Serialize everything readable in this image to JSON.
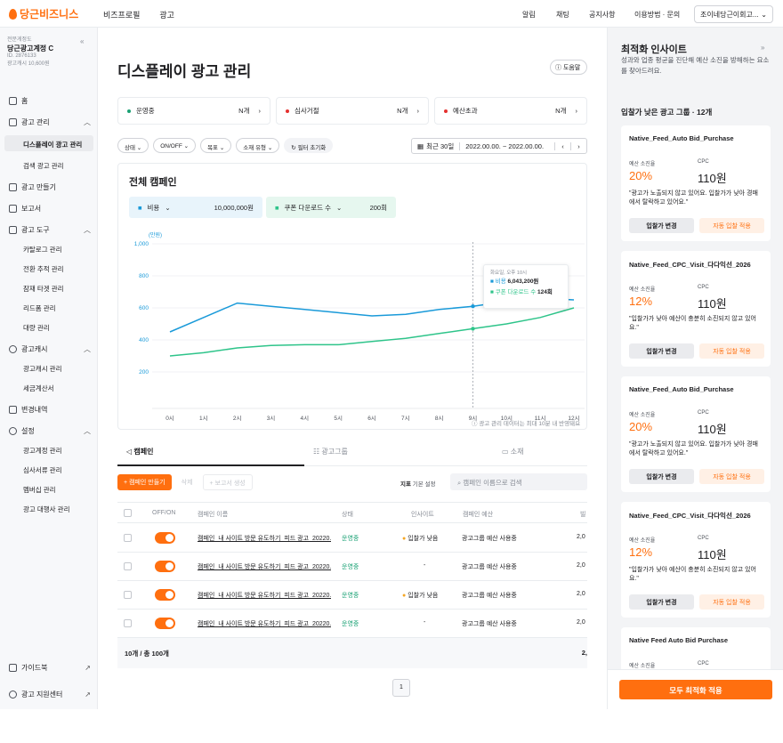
{
  "brand": {
    "logo": "당근비즈니스"
  },
  "topnav": [
    "비즈프로필",
    "광고"
  ],
  "topright": {
    "alarm": "알림",
    "chat": "채팅",
    "notice": "공지사항",
    "guide": "이용방법 · 문의",
    "account": "조이네당근이회고..."
  },
  "sidebar": {
    "acct_tag": "전문게정도",
    "acct_name": "당근광고계정 C",
    "acct_id": "ID. 2876133",
    "acct_money": "광고캐시 10,600원",
    "items": {
      "home": "홈",
      "ad_manage": "광고 관리",
      "display": "디스플레이 광고 관리",
      "search": "검색 광고 관리",
      "make": "광고 만들기",
      "report": "보고서",
      "tools": "광고 도구",
      "catalog": "카탈로그 관리",
      "conv": "전환 추적 관리",
      "audience": "잠재 타겟 관리",
      "retarget": "리드폼 관리",
      "etc": "대량 관리",
      "cash": "광고캐시",
      "cash_manage": "광고캐시 관리",
      "tax": "세금계산서",
      "history": "변경내역",
      "settings": "설정",
      "acct_manage": "광고계정 관리",
      "docs": "심사서류 관리",
      "members": "멤버십 관리",
      "agency": "광고 대행사 관리",
      "guidebook": "가이드북",
      "support": "광고 지원센터"
    }
  },
  "main": {
    "title": "디스플레이 광고 관리",
    "help": "도움말",
    "status": [
      {
        "label": "운영중",
        "count": "N개",
        "color": "#1aa174"
      },
      {
        "label": "심사거절",
        "count": "N개",
        "color": "#e5302e"
      },
      {
        "label": "예산초과",
        "count": "N개",
        "color": "#e5302e"
      }
    ],
    "filters": [
      "상태",
      "ON/OFF",
      "목표",
      "소재 유형",
      "필터 초기화"
    ],
    "date_label": "최근 30일",
    "date_range": "2022.00.00. ~ 2022.00.00.",
    "chart_title": "전체 캠페인",
    "metric1": {
      "label": "비용",
      "value": "10,000,000원"
    },
    "metric2": {
      "label": "쿠폰 다운로드 수",
      "value": "200회"
    },
    "tooltip": {
      "time": "화요일, 오후 10시",
      "cost_label": "비용",
      "cost_value": "6,043,200원",
      "coupon_label": "쿠폰 다운로드 수",
      "coupon_value": "124회"
    },
    "note": "광고 관리 데이터는 최대 10분 내 반영돼요",
    "tabs": [
      "캠페인",
      "광고그룹",
      "소재"
    ],
    "actions": {
      "new": "+ 캠페인 만들기",
      "delete": "삭제",
      "report": "+ 보고서 생성",
      "indicator": "지표",
      "basic": "기본 설정"
    },
    "search_placeholder": "캠페인 이름으로 검색",
    "table": {
      "headers": [
        "OFF/ON",
        "캠페인 이름",
        "상태",
        "인사이트",
        "캠페인 예산"
      ],
      "rows": [
        {
          "name": "캠페인_내 사이트 방문 유도하기_피드 광고_20220...",
          "status": "운영중",
          "insight": "입찰가 낮음",
          "budget": "광고그룹 예산 사용중",
          "extra": "2,0"
        },
        {
          "name": "캠페인_내 사이트 방문 유도하기_피드 광고_20220...",
          "status": "운영중",
          "insight": "-",
          "budget": "광고그룹 예산 사용중",
          "extra": "2,0"
        },
        {
          "name": "캠페인_내 사이트 방문 유도하기_피드 광고_20220...",
          "status": "운영중",
          "insight": "입찰가 낮음",
          "budget": "광고그룹 예산 사용중",
          "extra": "2,0"
        },
        {
          "name": "캠페인_내 사이트 방문 유도하기_피드 광고_20220...",
          "status": "운영중",
          "insight": "-",
          "budget": "광고그룹 예산 사용중",
          "extra": "2,0"
        }
      ],
      "footer": "10개 / 총 100개",
      "footer_extra": "2,"
    },
    "page": "1"
  },
  "chart_data": {
    "type": "line",
    "ylabel": "(만원)",
    "ylim": [
      0,
      1000
    ],
    "yticks": [
      "1,000",
      "800",
      "600",
      "400",
      "200"
    ],
    "categories": [
      "0시",
      "1시",
      "2시",
      "3시",
      "4시",
      "5시",
      "6시",
      "7시",
      "8시",
      "9시",
      "10시",
      "11시",
      "12시"
    ],
    "series": [
      {
        "name": "비용",
        "color": "#1a9ad9",
        "values": [
          450,
          540,
          630,
          610,
          590,
          570,
          550,
          560,
          590,
          610,
          640,
          660,
          650
        ]
      },
      {
        "name": "쿠폰 다운로드 수",
        "color": "#2ec48a",
        "values": [
          300,
          320,
          350,
          365,
          370,
          370,
          390,
          410,
          440,
          470,
          500,
          540,
          600
        ]
      }
    ]
  },
  "panel": {
    "title": "최적화 인사이트",
    "desc": "성과와 업종 평균을 진단해 예산 소진을 방해하는 요소를 찾아드려요.",
    "section": "입찰가 낮은 광고 그룹 · 12개",
    "cards": [
      {
        "name": "Native_Feed_Auto Bid_Purchase",
        "l1": "예산 소진율",
        "v1": "20%",
        "l2": "CPC",
        "v2": "110원",
        "desc": "\"광고가 노출되지 않고 있어요. 입찰가가 낮아 경매에서 탈락하고 있어요.\"",
        "b1": "입찰가 변경",
        "b2": "자동 입찰 적용"
      },
      {
        "name": "Native_Feed_CPC_Visit_다다익선_2026",
        "l1": "예산 소진율",
        "v1": "12%",
        "l2": "CPC",
        "v2": "110원",
        "desc": "\"입찰가가 낮아 예산이 충분히 소진되지 않고 있어요.\"",
        "b1": "입찰가 변경",
        "b2": "자동 입찰 적용"
      },
      {
        "name": "Native_Feed_Auto Bid_Purchase",
        "l1": "예산 소진율",
        "v1": "20%",
        "l2": "CPC",
        "v2": "110원",
        "desc": "\"광고가 노출되지 않고 있어요. 입찰가가 낮아 경매에서 탈락하고 있어요.\"",
        "b1": "입찰가 변경",
        "b2": "자동 입찰 적용"
      },
      {
        "name": "Native_Feed_CPC_Visit_다다익선_2026",
        "l1": "예산 소진율",
        "v1": "12%",
        "l2": "CPC",
        "v2": "110원",
        "desc": "\"입찰가가 낮아 예산이 충분히 소진되지 않고 있어요.\"",
        "b1": "입찰가 변경",
        "b2": "자동 입찰 적용"
      },
      {
        "name": "Native Feed Auto Bid Purchase",
        "l1": "예산 소진율",
        "v1": "",
        "l2": "CPC",
        "v2": "",
        "desc": "",
        "b1": "",
        "b2": ""
      }
    ],
    "apply_all": "모두 최적화 적용"
  }
}
